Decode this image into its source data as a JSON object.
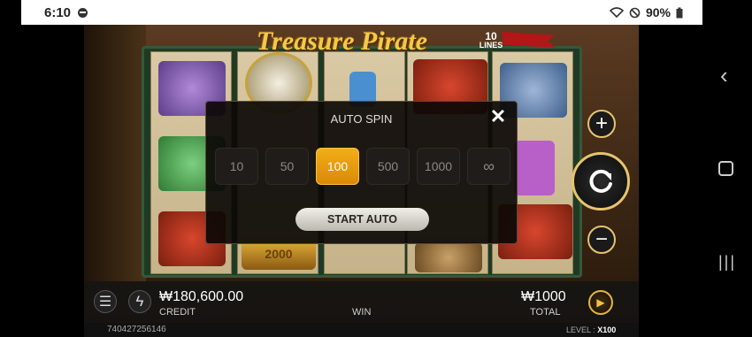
{
  "status_bar": {
    "time": "6:10",
    "battery": "90%"
  },
  "game": {
    "title": "Treasure Pirate",
    "lines_number": "10",
    "lines_label": "LINES"
  },
  "modal": {
    "title": "AUTO SPIN",
    "close": "✕",
    "options": [
      "10",
      "50",
      "100",
      "500",
      "1000",
      "∞"
    ],
    "selected": "100",
    "start_label": "START AUTO"
  },
  "bottom": {
    "credit_value": "₩180,600.00",
    "credit_label": "CREDIT",
    "win_label": "WIN",
    "total_value": "₩1000",
    "total_label": "TOTAL"
  },
  "footer": {
    "account_id": "740427256146",
    "level_label": "LEVEL :",
    "level_value": "X100"
  },
  "reel_texts": {
    "symbol_value": "2000"
  },
  "colors": {
    "accent": "#f4ad18",
    "gold": "#e7c46c"
  }
}
